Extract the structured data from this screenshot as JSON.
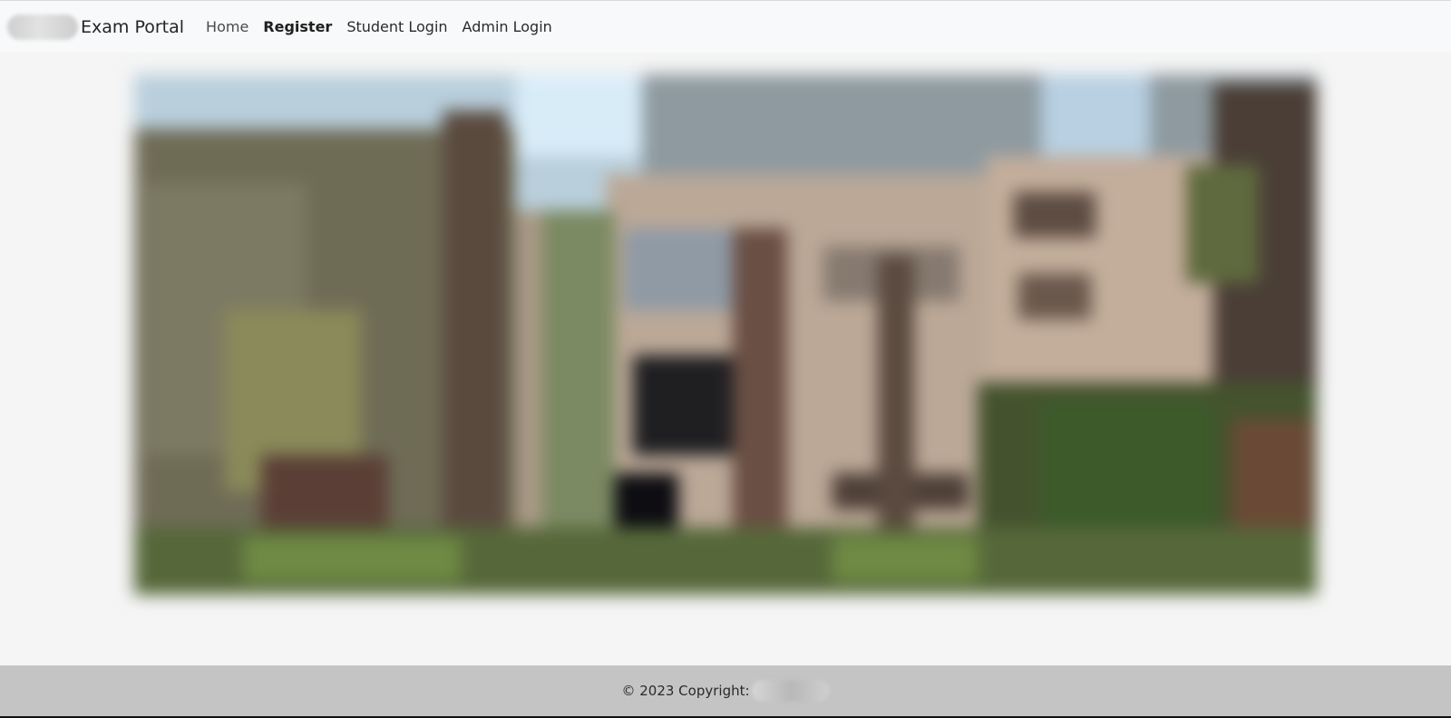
{
  "navbar": {
    "brand_text": "Exam Portal",
    "links": [
      {
        "label": "Home",
        "active": false
      },
      {
        "label": "Register",
        "active": true
      },
      {
        "label": "Student Login",
        "active": false
      },
      {
        "label": "Admin Login",
        "active": false
      }
    ]
  },
  "hero": {
    "image": "blurred-campus-building-photo"
  },
  "footer": {
    "copyright_text": "© 2023 Copyright:"
  },
  "colors": {
    "navbar_bg": "#f8f9fa",
    "page_bg": "#f5f5f5",
    "footer_bg": "#c4c4c4"
  }
}
